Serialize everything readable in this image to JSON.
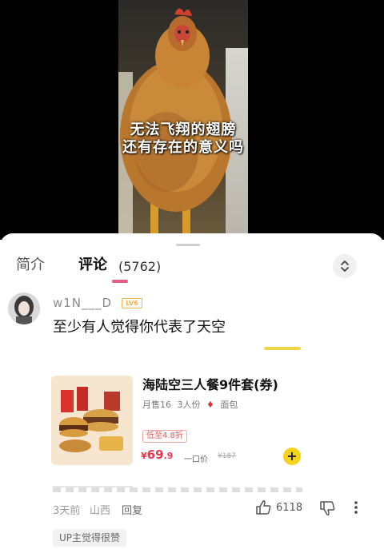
{
  "video": {
    "caption_line1": "无法飞翔的翅膀",
    "caption_line2": "还有存在的意义吗"
  },
  "tabs": {
    "intro": "简介",
    "comments": "评论",
    "comments_count": "(5762)"
  },
  "comment": {
    "username": "w1N___D",
    "level_badge": "LV6",
    "text": "至少有人觉得你代表了天空",
    "time": "3天前",
    "location": "山西",
    "reply_label": "回复",
    "like_count": "6118",
    "up_badge": "UP主觉得很赞"
  },
  "product": {
    "title": "海陆空三人餐9件套(券)",
    "sales": "月售16",
    "servings": "3人份",
    "taste": "面包",
    "discount_tag": "低至4.8折",
    "price_symbol": "¥",
    "price_int": "69",
    "price_dec": ".9",
    "price_unit": "一口价",
    "original_price": "¥187",
    "add_symbol": "+"
  },
  "colors": {
    "accent_pink": "#e85d86",
    "price_red": "#e8384f",
    "add_yellow": "#f5d21d"
  },
  "icons": [
    "chevron-up-down-icon",
    "thumb-up-icon",
    "thumb-down-icon",
    "more-vertical-icon",
    "chili-icon"
  ]
}
